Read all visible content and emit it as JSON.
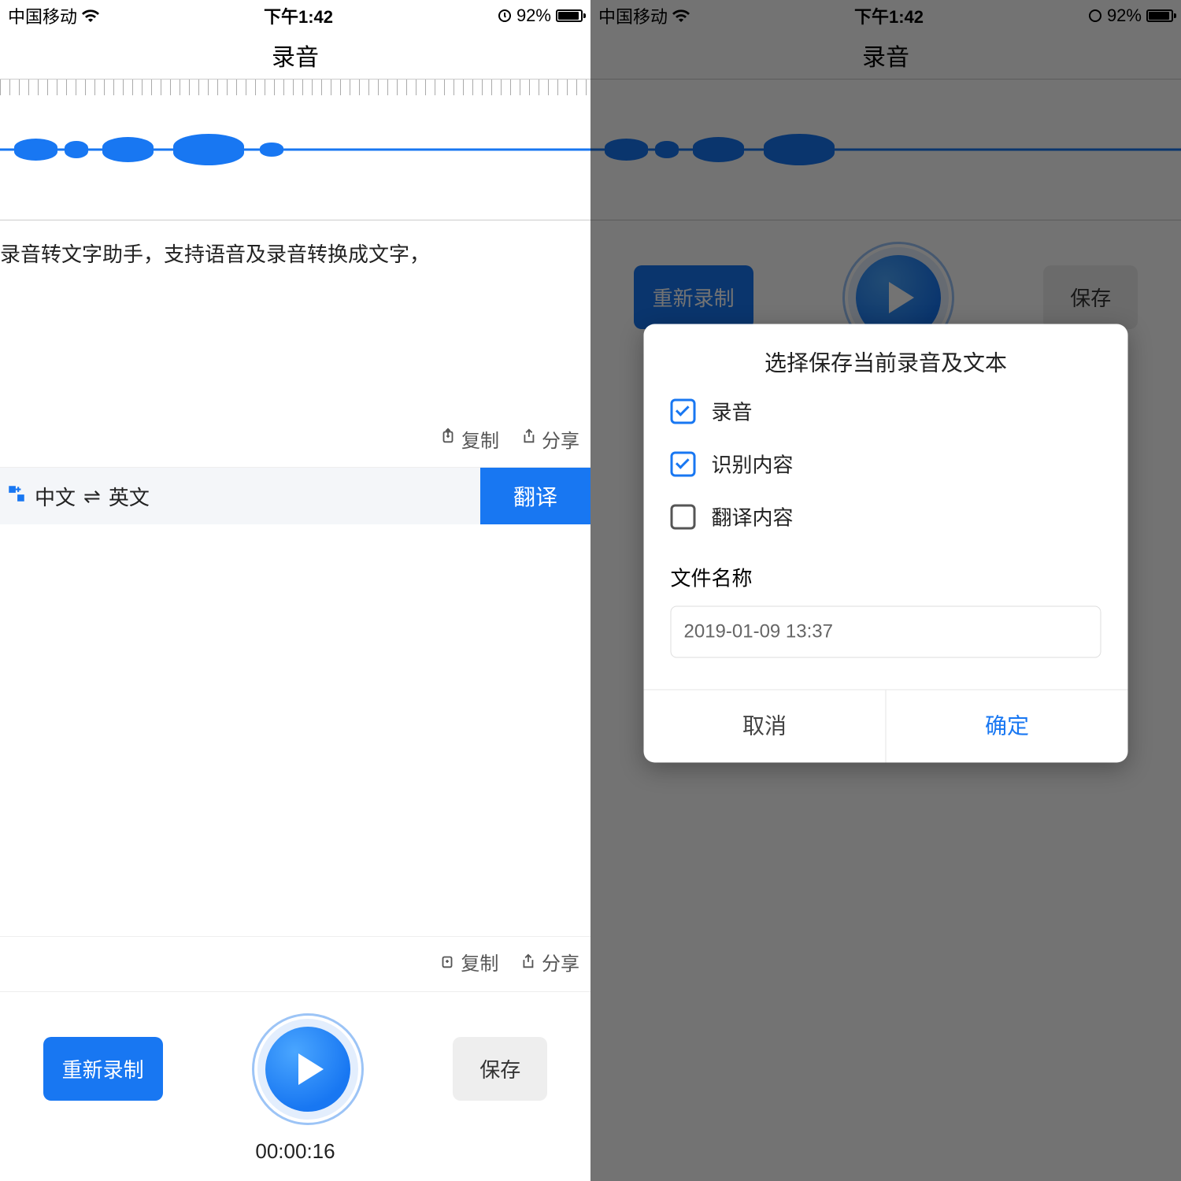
{
  "statusbar": {
    "carrier": "中国移动",
    "time": "下午1:42",
    "battery_pct": "92%"
  },
  "nav": {
    "title": "录音"
  },
  "result_text": "录音转文字助手，支持语音及录音转换成文字，",
  "actions": {
    "copy": "复制",
    "share": "分享"
  },
  "translate": {
    "lang_from": "中文",
    "lang_to": "英文",
    "button": "翻译"
  },
  "bottom": {
    "rerecord": "重新录制",
    "save": "保存",
    "time": "00:00:16"
  },
  "dialog": {
    "title": "选择保存当前录音及文本",
    "items": [
      {
        "label": "录音",
        "checked": true
      },
      {
        "label": "识别内容",
        "checked": true
      },
      {
        "label": "翻译内容",
        "checked": false
      }
    ],
    "filename_label": "文件名称",
    "filename_value": "2019-01-09 13:37",
    "cancel": "取消",
    "confirm": "确定"
  }
}
